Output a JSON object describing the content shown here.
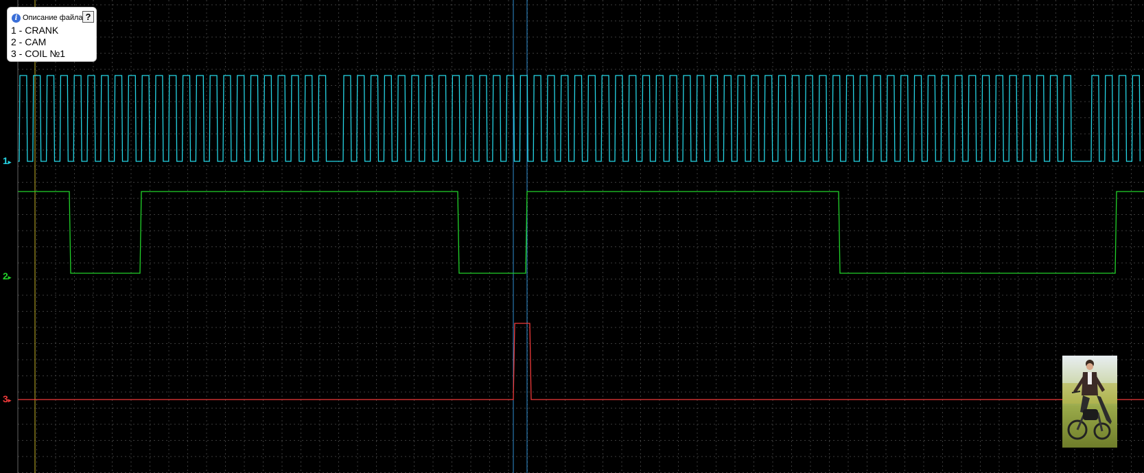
{
  "legend": {
    "title": "Описание файла",
    "help_label": "?",
    "info_icon_glyph": "i",
    "lines": [
      "1 - CRANK",
      "2 - CAM",
      "3 - COIL №1"
    ]
  },
  "channels": [
    {
      "number": "1",
      "name": "CRANK",
      "color": "#25d6e6"
    },
    {
      "number": "2",
      "name": "CAM",
      "color": "#22d42a"
    },
    {
      "number": "3",
      "name": "COIL №1",
      "color": "#f03a3a"
    }
  ],
  "colors": {
    "background": "#000000",
    "grid": "#3c3c3c",
    "cursor_yellow": "#c8b428",
    "cursor_blue": "#2f8fd4"
  },
  "photo": {
    "icon": "person-on-moped-photo"
  }
}
